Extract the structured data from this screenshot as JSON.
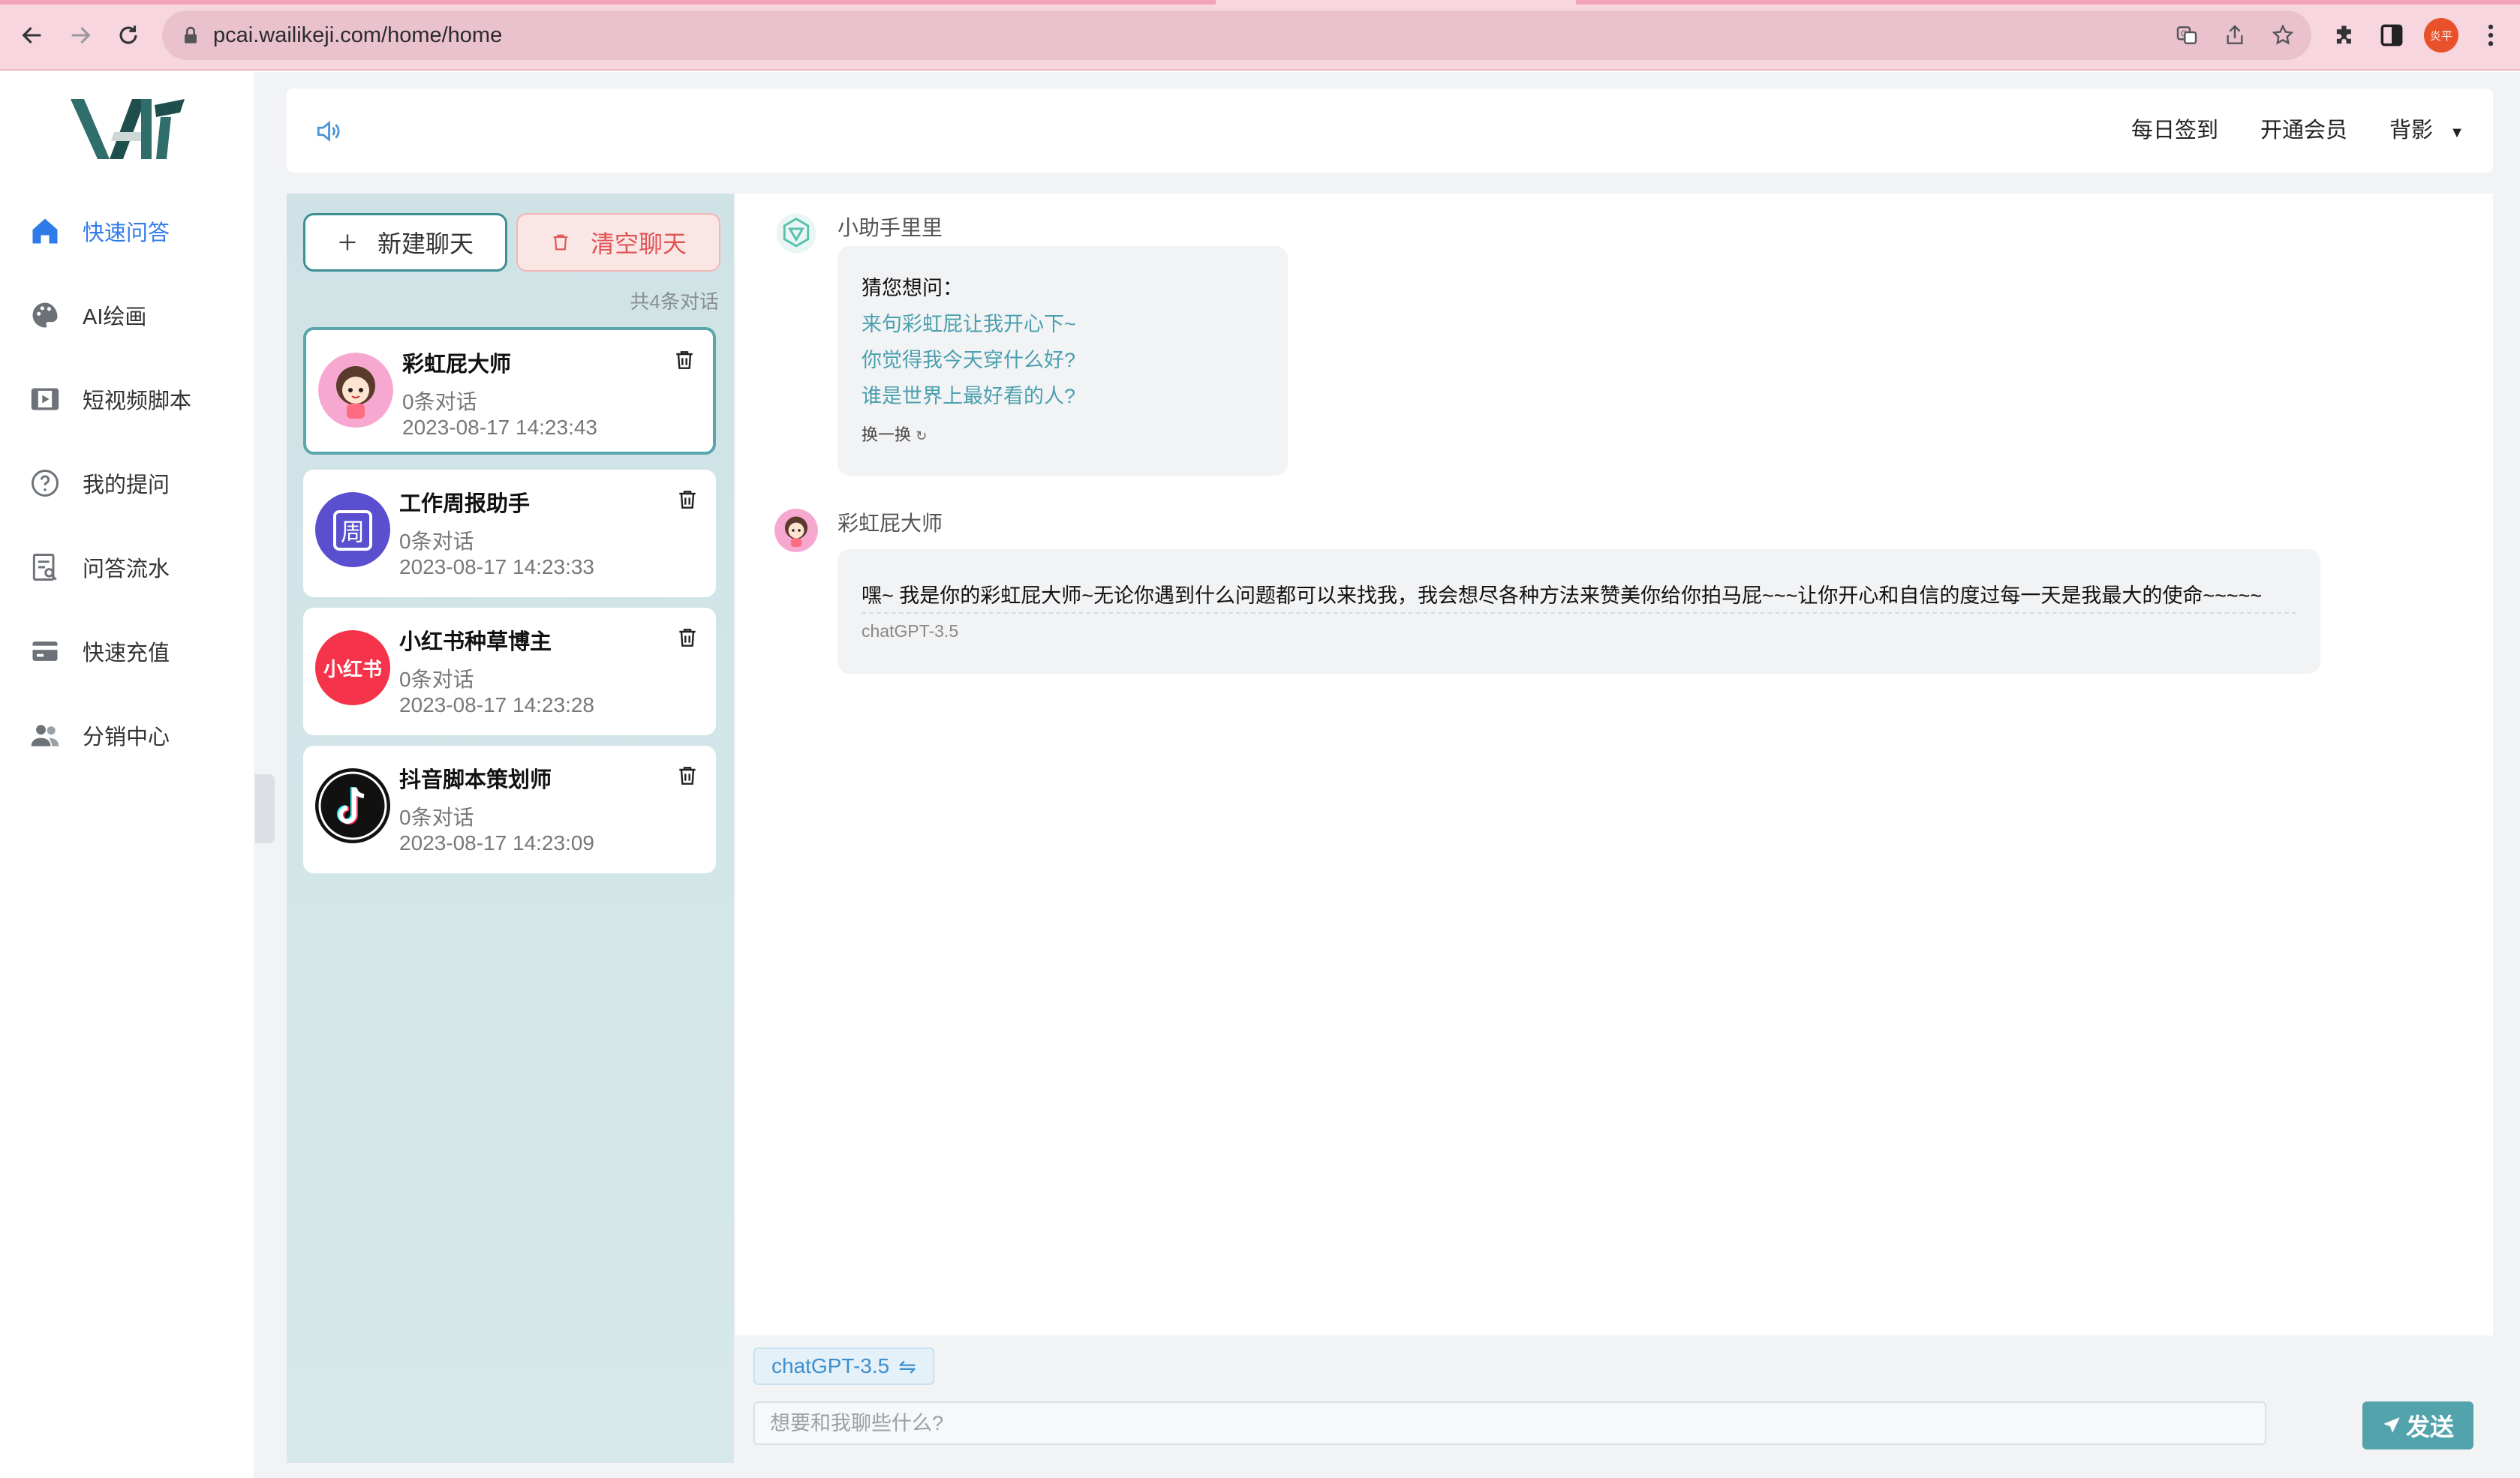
{
  "browser": {
    "url": "pcai.wailikeji.com/home/home",
    "profile_initials": "炎平"
  },
  "sidebar": {
    "items": [
      {
        "label": "快速问答",
        "icon": "home-icon",
        "active": true
      },
      {
        "label": "AI绘画",
        "icon": "palette-icon",
        "active": false
      },
      {
        "label": "短视频脚本",
        "icon": "film-icon",
        "active": false
      },
      {
        "label": "我的提问",
        "icon": "question-circle-icon",
        "active": false
      },
      {
        "label": "问答流水",
        "icon": "document-search-icon",
        "active": false
      },
      {
        "label": "快速充值",
        "icon": "wallet-icon",
        "active": false
      },
      {
        "label": "分销中心",
        "icon": "users-icon",
        "active": false
      }
    ]
  },
  "header": {
    "checkin": "每日签到",
    "membership": "开通会员",
    "user": "背影"
  },
  "chat_panel": {
    "new_chat": "新建聊天",
    "clear_chat": "清空聊天",
    "total": "共4条对话",
    "chats": [
      {
        "name": "彩虹屁大师",
        "count": "0条对话",
        "time": "2023-08-17 14:23:43",
        "active": true
      },
      {
        "name": "工作周报助手",
        "count": "0条对话",
        "time": "2023-08-17 14:23:33",
        "active": false
      },
      {
        "name": "小红书种草博主",
        "count": "0条对话",
        "time": "2023-08-17 14:23:28",
        "active": false
      },
      {
        "name": "抖音脚本策划师",
        "count": "0条对话",
        "time": "2023-08-17 14:23:09",
        "active": false
      }
    ],
    "avatar_texts": {
      "weekly": "周",
      "xhs": "小红书"
    }
  },
  "conversation": {
    "assistant_name": "小助手里里",
    "guess_title": "猜您想问：",
    "questions": [
      "来句彩虹屁让我开心下~",
      "你觉得我今天穿什么好?",
      "谁是世界上最好看的人?"
    ],
    "refresh": "换一换",
    "bot_name": "彩虹屁大师",
    "reply": "嘿~ 我是你的彩虹屁大师~无论你遇到什么问题都可以来找我，我会想尽各种方法来赞美你给你拍马屁~~~让你开心和自信的度过每一天是我最大的使命~~~~~",
    "reply_model": "chatGPT-3.5"
  },
  "input": {
    "model": "chatGPT-3.5",
    "placeholder": "想要和我聊些什么?",
    "send": "发送"
  },
  "colors": {
    "accent": "#2f7bea",
    "teal": "#53a3ac",
    "danger": "#e05454",
    "link": "#4aa0ae"
  }
}
